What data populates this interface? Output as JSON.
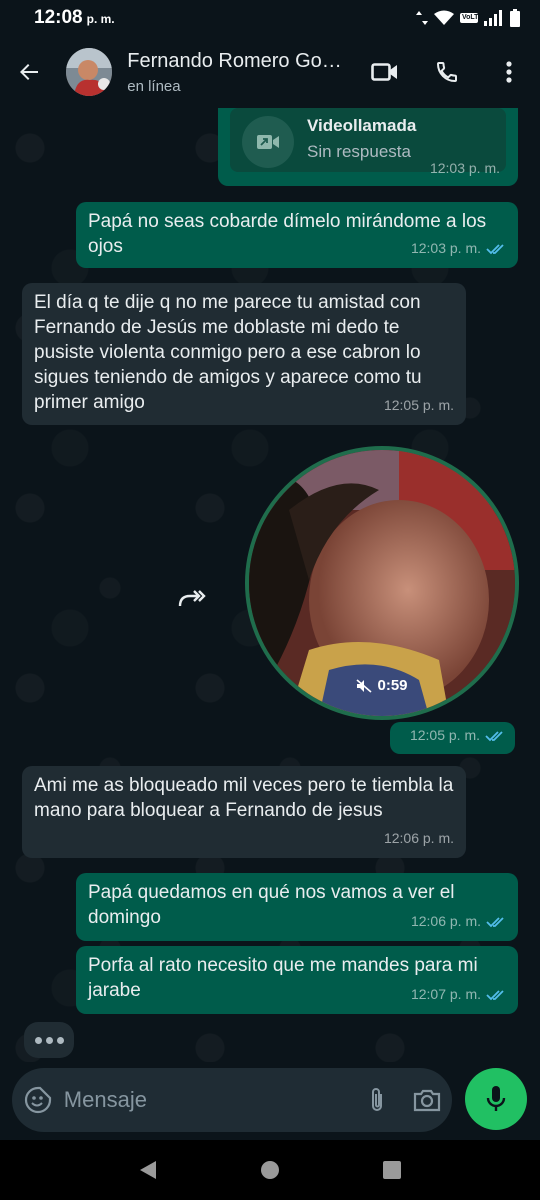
{
  "status_bar": {
    "time": "12:08",
    "period": "p. m.",
    "network_badge": "VoLTE"
  },
  "header": {
    "contact_name": "Fernando Romero Go…",
    "contact_status": "en línea"
  },
  "messages": [
    {
      "kind": "call",
      "direction": "out",
      "title": "Videollamada",
      "subtitle": "Sin respuesta",
      "time": "12:03 p. m."
    },
    {
      "kind": "text",
      "direction": "out",
      "text": "Papá no seas cobarde dímelo mirándome a los ojos",
      "time": "12:03 p. m.",
      "read": true
    },
    {
      "kind": "text",
      "direction": "in",
      "text": "El día q te dije q no me parece tu amistad con Fernando de Jesús me doblaste mi dedo te pusiste violenta conmigo pero a ese cabron lo sigues teniendo de amigos y aparece como tu primer amigo",
      "time": "12:05 p. m."
    },
    {
      "kind": "video_note",
      "direction": "out",
      "duration": "0:59",
      "time": "12:05 p. m.",
      "read": true
    },
    {
      "kind": "text",
      "direction": "in",
      "text": "Ami me as bloqueado mil veces pero te tiembla la mano para bloquear a Fernando de jesus",
      "time": "12:06 p. m."
    },
    {
      "kind": "text",
      "direction": "out",
      "text": "Papá quedamos en qué nos vamos a ver el domingo",
      "time": "12:06 p. m.",
      "read": true
    },
    {
      "kind": "text",
      "direction": "out",
      "text": "Porfa al rato necesito que me mandes para mi jarabe",
      "time": "12:07 p. m.",
      "read": true
    }
  ],
  "composer": {
    "placeholder": "Mensaje"
  },
  "icons": {
    "back": "arrow-left-icon",
    "video_call": "video-camera-icon",
    "voice_call": "phone-icon",
    "menu": "more-vertical-icon",
    "emoji": "sticker-emoji-icon",
    "attach": "paperclip-icon",
    "camera": "camera-icon",
    "mic": "microphone-icon",
    "forward": "forward-icon",
    "muted": "speaker-muted-icon",
    "read_receipt": "double-check-icon"
  },
  "colors": {
    "background": "#0b141a",
    "outgoing_bubble": "#005c4b",
    "incoming_bubble": "#202c33",
    "accent": "#21c063",
    "read_check": "#53bdeb"
  }
}
